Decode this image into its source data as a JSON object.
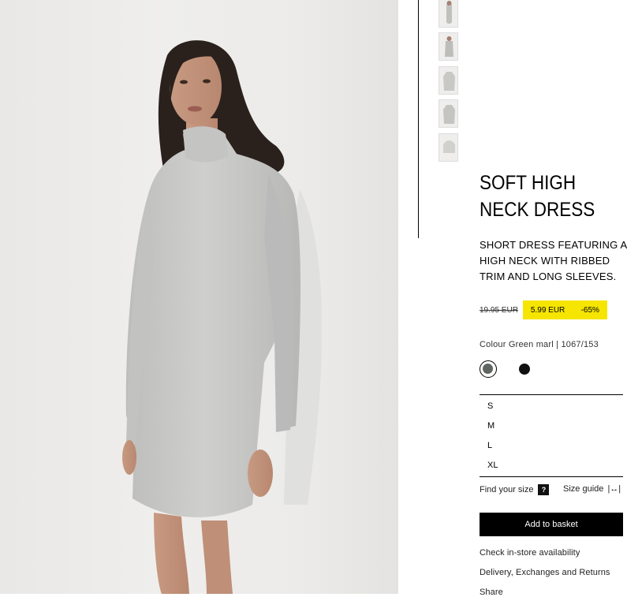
{
  "product": {
    "title": "SOFT HIGH NECK DRESS",
    "description": "SHORT DRESS FEATURING A HIGH NECK WITH RIBBED TRIM AND LONG SLEEVES.",
    "old_price": "19.95 EUR",
    "sale_price": "5.99 EUR",
    "discount": "-65%",
    "colour_line": "Colour Green marl | 1067/153",
    "colours": [
      {
        "name": "Green marl",
        "hex": "#5f6661",
        "selected": true
      },
      {
        "name": "Black",
        "hex": "#111111",
        "selected": false
      }
    ],
    "sizes": [
      "S",
      "M",
      "L",
      "XL"
    ]
  },
  "actions": {
    "find_size": "Find your size",
    "find_size_help": "?",
    "size_guide": "Size guide",
    "size_guide_icon": "|↔|",
    "add_to_basket": "Add to basket",
    "store_availability": "Check in-store availability",
    "delivery": "Delivery, Exchanges and Returns",
    "share": "Share"
  },
  "colors": {
    "sale_highlight": "#f6e500",
    "button_bg": "#000000"
  },
  "icons": {
    "help": "question-mark-icon",
    "size_guide": "ruler-icon"
  }
}
